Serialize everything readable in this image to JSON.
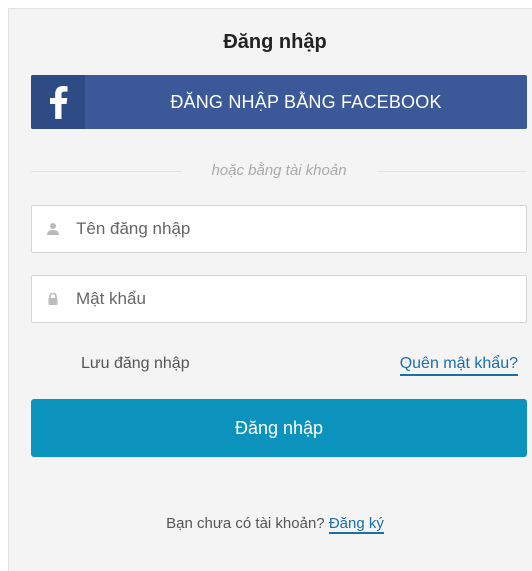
{
  "login_form": {
    "title": "Đăng nhập",
    "facebook_button_label": "ĐĂNG NHẬP BẰNG FACEBOOK",
    "divider_text": "hoặc bằng tài khoản",
    "username_placeholder": "Tên đăng nhập",
    "password_placeholder": "Mật khẩu",
    "remember_label": "Lưu đăng nhập",
    "forgot_password_link": "Quên mật khẩu?",
    "submit_button_label": "Đăng nhập",
    "signup_prompt": "Bạn chưa có tài khoản?",
    "signup_link": "Đăng ký"
  },
  "icons": {
    "facebook": "facebook-icon",
    "user": "user-icon",
    "lock": "lock-icon"
  },
  "colors": {
    "facebook_blue": "#3b5998",
    "primary_button": "#0b93bd",
    "link": "#1a6fa8",
    "panel_background": "#f4f4f4"
  }
}
